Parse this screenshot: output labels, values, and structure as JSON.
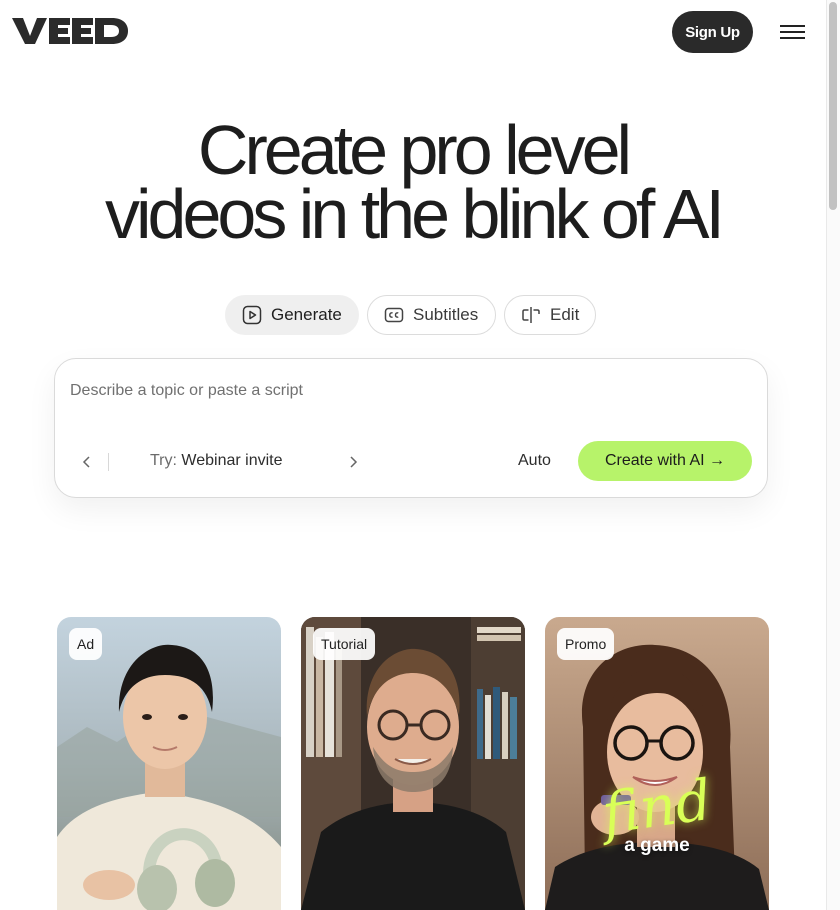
{
  "header": {
    "logo_text": "VEED",
    "signup_label": "Sign Up",
    "menu_icon": "hamburger-menu-icon"
  },
  "hero": {
    "title_line1": "Create pro level",
    "title_line2": "videos in the blink of AI"
  },
  "tabs": [
    {
      "label": "Generate",
      "icon": "play-square-icon",
      "active": true
    },
    {
      "label": "Subtitles",
      "icon": "closed-captions-icon",
      "active": false
    },
    {
      "label": "Edit",
      "icon": "cut-split-icon",
      "active": false
    }
  ],
  "prompt": {
    "placeholder": "Describe a topic or paste a script",
    "value": "",
    "try_prefix": "Try:",
    "try_suggestion": "Webinar invite",
    "auto_label": "Auto",
    "create_label": "Create with AI →"
  },
  "cards": [
    {
      "badge": "Ad"
    },
    {
      "badge": "Tutorial"
    },
    {
      "badge": "Promo",
      "overlay_big": "find",
      "overlay_small": "a game"
    }
  ],
  "colors": {
    "accent": "#b7f36a",
    "dark_button": "#2a2a2a",
    "overlay_neon": "#d9ff57"
  }
}
